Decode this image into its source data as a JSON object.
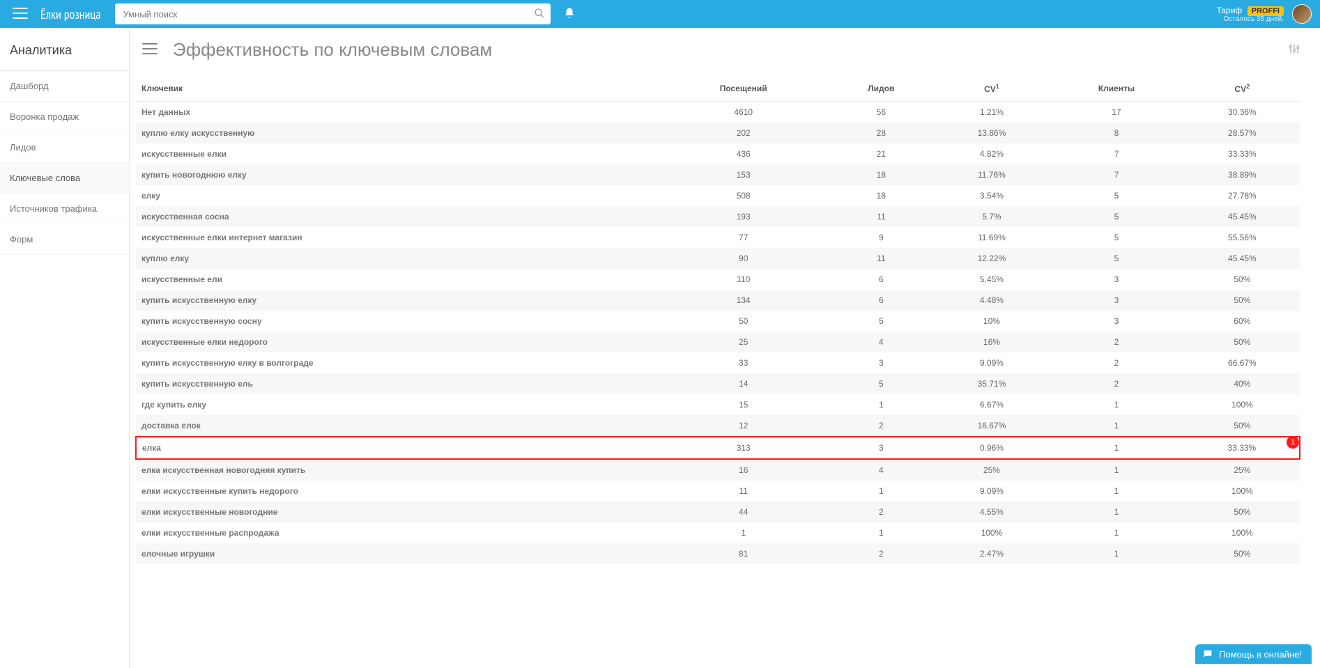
{
  "topbar": {
    "brand": "Ёлки розница",
    "search_placeholder": "Умный поиск",
    "tariff_label": "Тариф",
    "tariff_badge": "PROFFI",
    "tariff_remaining": "Осталось 35 дней."
  },
  "sidebar": {
    "category": "Аналитика",
    "items": [
      {
        "label": "Дашборд",
        "active": false
      },
      {
        "label": "Воронка продаж",
        "active": false
      },
      {
        "label": "Лидов",
        "active": false
      },
      {
        "label": "Ключевые слова",
        "active": true
      },
      {
        "label": "Источников трафика",
        "active": false
      },
      {
        "label": "Форм",
        "active": false
      }
    ]
  },
  "page": {
    "title": "Эффективность по ключевым словам"
  },
  "table": {
    "columns": [
      "Ключевик",
      "Посещений",
      "Лидов",
      "CV¹",
      "Клиенты",
      "CV²"
    ],
    "rows": [
      {
        "k": "Нет данных",
        "v": [
          "4610",
          "56",
          "1.21%",
          "17",
          "30.36%"
        ],
        "hl": false
      },
      {
        "k": "куплю елку искусственную",
        "v": [
          "202",
          "28",
          "13.86%",
          "8",
          "28.57%"
        ],
        "hl": false
      },
      {
        "k": "искусственные елки",
        "v": [
          "436",
          "21",
          "4.82%",
          "7",
          "33.33%"
        ],
        "hl": false
      },
      {
        "k": "купить новогоднюю елку",
        "v": [
          "153",
          "18",
          "11.76%",
          "7",
          "38.89%"
        ],
        "hl": false
      },
      {
        "k": "елку",
        "v": [
          "508",
          "18",
          "3.54%",
          "5",
          "27.78%"
        ],
        "hl": false
      },
      {
        "k": "искусственная сосна",
        "v": [
          "193",
          "11",
          "5.7%",
          "5",
          "45.45%"
        ],
        "hl": false
      },
      {
        "k": "искусственные елки интернет магазин",
        "v": [
          "77",
          "9",
          "11.69%",
          "5",
          "55.56%"
        ],
        "hl": false
      },
      {
        "k": "куплю елку",
        "v": [
          "90",
          "11",
          "12.22%",
          "5",
          "45.45%"
        ],
        "hl": false
      },
      {
        "k": "искусственные ели",
        "v": [
          "110",
          "6",
          "5.45%",
          "3",
          "50%"
        ],
        "hl": false
      },
      {
        "k": "купить искусственную елку",
        "v": [
          "134",
          "6",
          "4.48%",
          "3",
          "50%"
        ],
        "hl": false
      },
      {
        "k": "купить искусственную сосну",
        "v": [
          "50",
          "5",
          "10%",
          "3",
          "60%"
        ],
        "hl": false
      },
      {
        "k": "искусственные елки недорого",
        "v": [
          "25",
          "4",
          "16%",
          "2",
          "50%"
        ],
        "hl": false
      },
      {
        "k": "купить искусственную елку в волгограде",
        "v": [
          "33",
          "3",
          "9.09%",
          "2",
          "66.67%"
        ],
        "hl": false
      },
      {
        "k": "купить искусственную ель",
        "v": [
          "14",
          "5",
          "35.71%",
          "2",
          "40%"
        ],
        "hl": false
      },
      {
        "k": "где купить елку",
        "v": [
          "15",
          "1",
          "6.67%",
          "1",
          "100%"
        ],
        "hl": false
      },
      {
        "k": "доставка елок",
        "v": [
          "12",
          "2",
          "16.67%",
          "1",
          "50%"
        ],
        "hl": false
      },
      {
        "k": "елка",
        "v": [
          "313",
          "3",
          "0.96%",
          "1",
          "33.33%"
        ],
        "hl": true,
        "badge": "1"
      },
      {
        "k": "елка искусственная новогодняя купить",
        "v": [
          "16",
          "4",
          "25%",
          "1",
          "25%"
        ],
        "hl": false
      },
      {
        "k": "елки искусственные купить недорого",
        "v": [
          "11",
          "1",
          "9.09%",
          "1",
          "100%"
        ],
        "hl": false
      },
      {
        "k": "елки искусственные новогодние",
        "v": [
          "44",
          "2",
          "4.55%",
          "1",
          "50%"
        ],
        "hl": false
      },
      {
        "k": "елки искусственные распродажа",
        "v": [
          "1",
          "1",
          "100%",
          "1",
          "100%"
        ],
        "hl": false
      },
      {
        "k": "елочные игрушки",
        "v": [
          "81",
          "2",
          "2.47%",
          "1",
          "50%"
        ],
        "hl": false
      }
    ]
  },
  "chat": {
    "label": "Помощь в онлайне!"
  }
}
